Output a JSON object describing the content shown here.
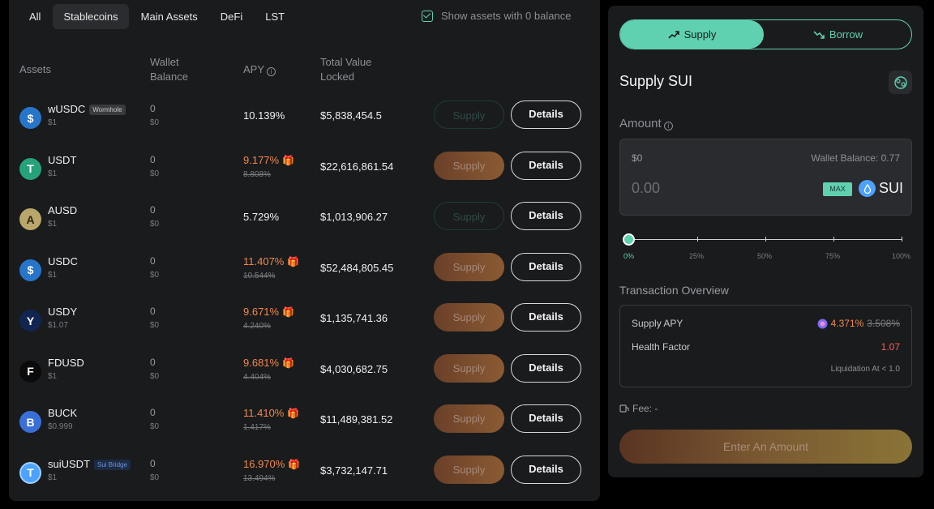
{
  "filters": {
    "tabs": [
      {
        "label": "All"
      },
      {
        "label": "Stablecoins"
      },
      {
        "label": "Main Assets"
      },
      {
        "label": "DeFi"
      },
      {
        "label": "LST"
      }
    ],
    "active_tab": "Stablecoins",
    "show_zero_label": "Show assets with 0 balance"
  },
  "columns": {
    "assets": "Assets",
    "wallet_balance": "Wallet Balance",
    "apy": "APY",
    "tvl": "Total Value Locked"
  },
  "rows": [
    {
      "name": "wUSDC",
      "badge": "Wormhole",
      "badge_style": "gray",
      "price": "$1",
      "balance": "0",
      "balance_usd": "$0",
      "apy": "10.139%",
      "apy_old": "",
      "tvl": "$5,838,454.5",
      "supply_label": "Supply",
      "supply_enabled": false,
      "details_label": "Details",
      "icon": "wusdc-icon",
      "icon_color": "#2775ca"
    },
    {
      "name": "USDT",
      "badge": "",
      "badge_style": "",
      "price": "$1",
      "balance": "0",
      "balance_usd": "$0",
      "apy": "9.177%",
      "apy_old": "8.808%",
      "tvl": "$22,616,861.54",
      "supply_label": "Supply",
      "supply_enabled": true,
      "details_label": "Details",
      "icon": "usdt-icon",
      "icon_color": "#26a17b"
    },
    {
      "name": "AUSD",
      "badge": "",
      "badge_style": "",
      "price": "$1",
      "balance": "0",
      "balance_usd": "$0",
      "apy": "5.729%",
      "apy_old": "",
      "tvl": "$1,013,906.27",
      "supply_label": "Supply",
      "supply_enabled": false,
      "details_label": "Details",
      "icon": "ausd-icon",
      "icon_color": "#b9a66a"
    },
    {
      "name": "USDC",
      "badge": "",
      "badge_style": "",
      "price": "$1",
      "balance": "0",
      "balance_usd": "$0",
      "apy": "11.407%",
      "apy_old": "10.544%",
      "tvl": "$52,484,805.45",
      "supply_label": "Supply",
      "supply_enabled": true,
      "details_label": "Details",
      "icon": "usdc-icon",
      "icon_color": "#2775ca"
    },
    {
      "name": "USDY",
      "badge": "",
      "badge_style": "",
      "price": "$1.07",
      "balance": "0",
      "balance_usd": "$0",
      "apy": "9.671%",
      "apy_old": "4.240%",
      "tvl": "$1,135,741.36",
      "supply_label": "Supply",
      "supply_enabled": true,
      "details_label": "Details",
      "icon": "usdy-icon",
      "icon_color": "#10254f"
    },
    {
      "name": "FDUSD",
      "badge": "",
      "badge_style": "",
      "price": "$1",
      "balance": "0",
      "balance_usd": "$0",
      "apy": "9.681%",
      "apy_old": "4.404%",
      "tvl": "$4,030,682.75",
      "supply_label": "Supply",
      "supply_enabled": true,
      "details_label": "Details",
      "icon": "fdusd-icon",
      "icon_color": "#0b0b0b"
    },
    {
      "name": "BUCK",
      "badge": "",
      "badge_style": "",
      "price": "$0.999",
      "balance": "0",
      "balance_usd": "$0",
      "apy": "11.410%",
      "apy_old": "1.417%",
      "tvl": "$11,489,381.52",
      "supply_label": "Supply",
      "supply_enabled": true,
      "details_label": "Details",
      "icon": "buck-icon",
      "icon_color": "#3b6fd8"
    },
    {
      "name": "suiUSDT",
      "badge": "Sui Bridge",
      "badge_style": "blue",
      "price": "$1",
      "balance": "0",
      "balance_usd": "$0",
      "apy": "16.970%",
      "apy_old": "13.494%",
      "tvl": "$3,732,147.71",
      "supply_label": "Supply",
      "supply_enabled": true,
      "details_label": "Details",
      "icon": "suiusdt-icon",
      "icon_color": "#4da2ff"
    }
  ],
  "panel": {
    "supply_tab": "Supply",
    "borrow_tab": "Borrow",
    "title": "Supply SUI",
    "amount_label": "Amount",
    "amount_usd": "$0",
    "wallet_balance": "Wallet Balance: 0.77",
    "amount_placeholder": "0.00",
    "max_label": "MAX",
    "token": "SUI",
    "slider_level": 0,
    "slider_ticks": [
      "0%",
      "25%",
      "50%",
      "75%",
      "100%"
    ],
    "overview_label": "Transaction Overview",
    "supply_apy_label": "Supply APY",
    "supply_apy": "4.371%",
    "supply_apy_old": "3.508%",
    "health_factor_label": "Health Factor",
    "health_factor": "1.07",
    "liquidation": "Liquidation At < 1.0",
    "fee": "Fee: -",
    "cta": "Enter An Amount"
  },
  "colors": {
    "accent": "#5fd1b0",
    "boost": "#f0894a",
    "danger": "#ff5b5b"
  }
}
